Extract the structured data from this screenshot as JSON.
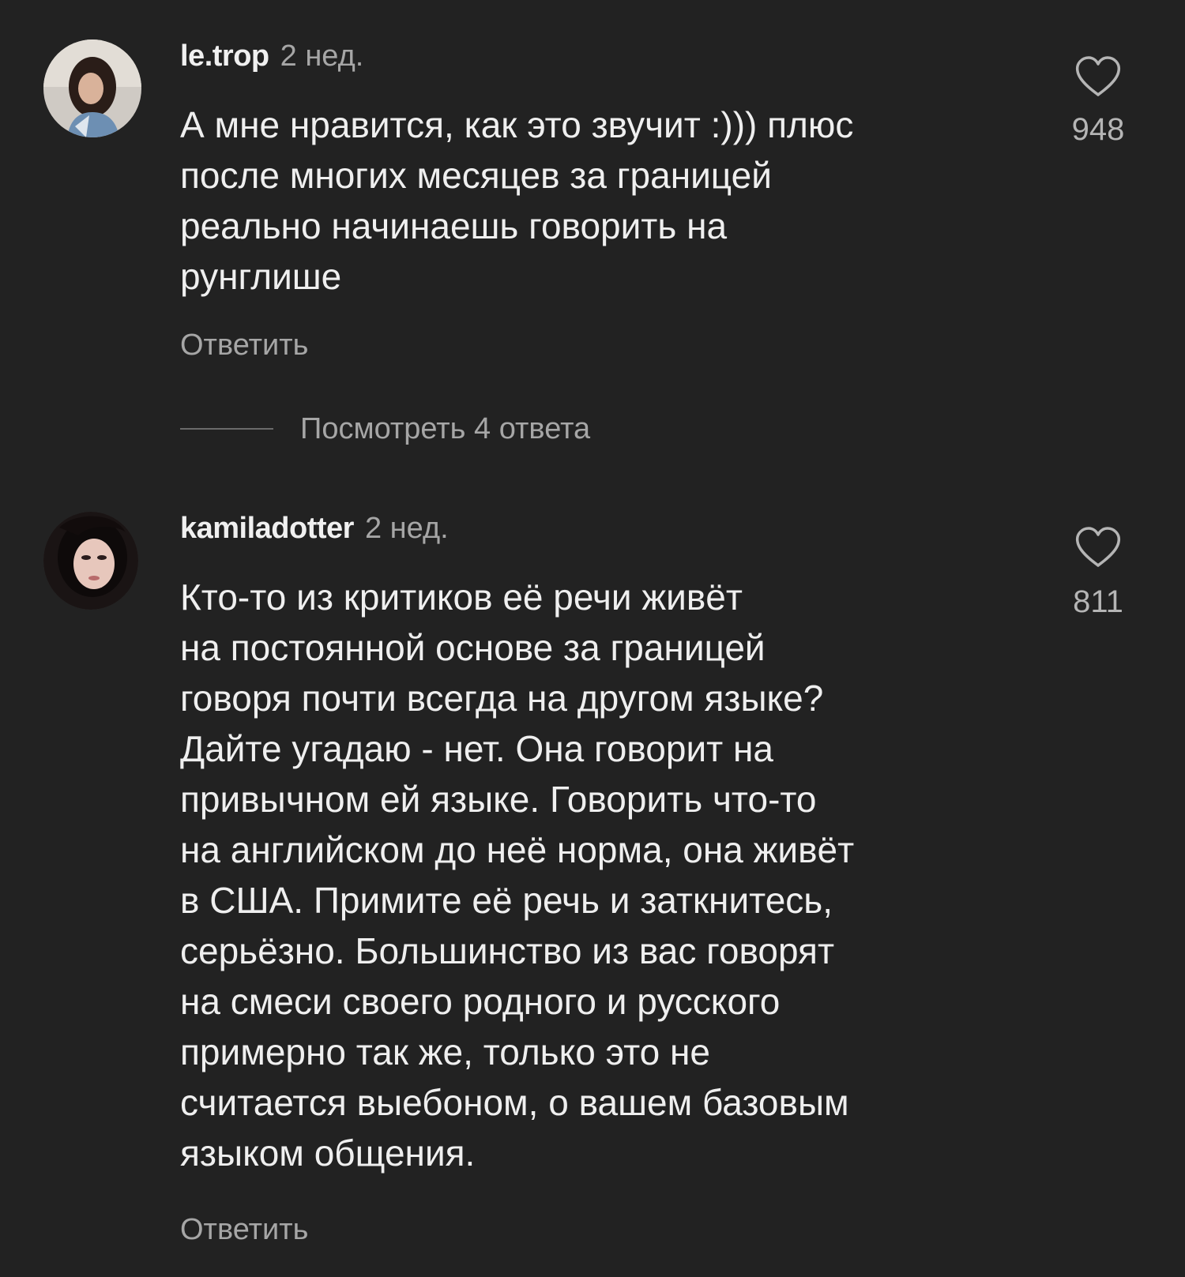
{
  "colors": {
    "background": "#222222",
    "primary_text": "#efefef",
    "secondary_text": "#a6a6a6",
    "heart_outline": "#b5b5b5"
  },
  "comments": [
    {
      "username": "le.trop",
      "time": "2 нед.",
      "text_lines": [
        "А мне нравится, как это звучит :))) плюс",
        "после многих месяцев за границей",
        "реально начинаешь говорить на",
        "рунглише"
      ],
      "likes": "948",
      "reply_label": "Ответить",
      "like_icon": "heart-outline-icon"
    },
    {
      "username": "kamiladotter",
      "time": "2 нед.",
      "text_lines": [
        "Кто-то из критиков её речи живёт",
        "на постоянной основе за границей",
        "говоря почти всегда на другом языке?",
        "Дайте угадаю - нет. Она говорит на",
        "привычном ей языке. Говорить что-то",
        "на английском до неё норма, она живёт",
        "в США. Примите её речь и заткнитесь,",
        "серьёзно. Большинство из вас говорят",
        "на смеси своего родного и русского",
        "примерно так же, только это не",
        "считается выебоном, о вашем базовым",
        "языком общения."
      ],
      "likes": "811",
      "reply_label": "Ответить",
      "like_icon": "heart-outline-icon"
    }
  ],
  "view_replies_label": "Посмотреть 4 ответа"
}
